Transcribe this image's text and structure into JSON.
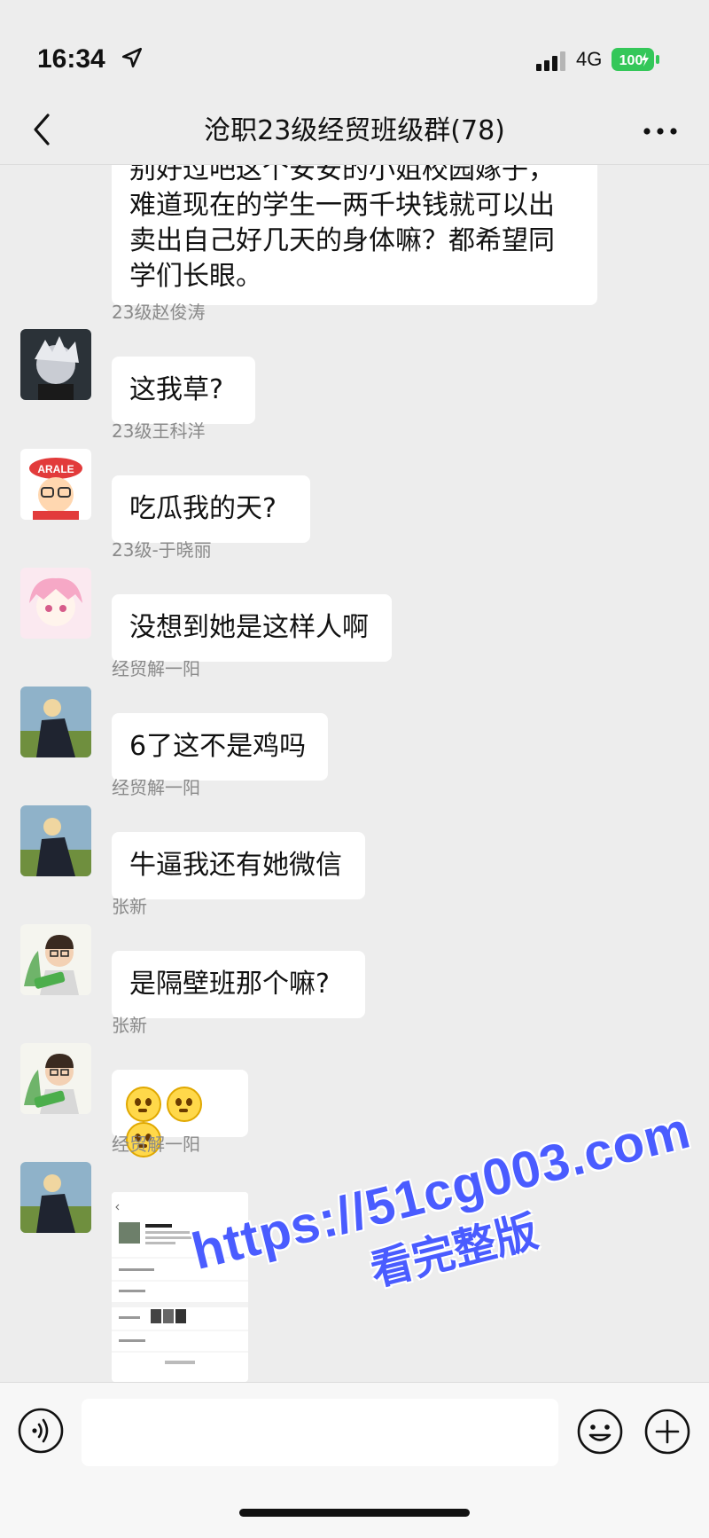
{
  "status": {
    "time": "16:34",
    "network": "4G",
    "battery": "100"
  },
  "nav": {
    "title": "沧职23级经贸班级群(78)"
  },
  "messages": [
    {
      "text": "别好过吧这个安安的小姐校园嫁子，难道现在的学生一两千块钱就可以出卖出自己好几天的身体嘛？都希望同学们长眼。"
    },
    {
      "sender": "23级赵俊涛",
      "text": "这我草?"
    },
    {
      "sender": "23级王科洋",
      "text": "吃瓜我的天?"
    },
    {
      "sender": "23级-于晓丽",
      "text": "没想到她是这样人啊"
    },
    {
      "sender": "经贸解一阳",
      "text": "6了这不是鸡吗"
    },
    {
      "sender": "经贸解一阳",
      "text": "牛逼我还有她微信"
    },
    {
      "sender": "张新",
      "text": "是隔壁班那个嘛?"
    },
    {
      "sender": "张新",
      "emojis": [
        "pleading-face-icon",
        "pleading-face-icon",
        "pleading-face-icon"
      ]
    },
    {
      "sender": "经贸解一阳",
      "image": "screenshot"
    }
  ],
  "watermark": {
    "url": "https://51cg003.com",
    "text": "看完整版"
  },
  "icons": {
    "back": "chevron-left-icon",
    "more": "more-dots-icon",
    "voice": "voice-icon",
    "emoji": "emoji-icon",
    "plus": "plus-icon"
  },
  "colors": {
    "battery": "#34c759",
    "watermark": "#4a5cff",
    "background": "#ededed",
    "bubble": "#ffffff"
  }
}
